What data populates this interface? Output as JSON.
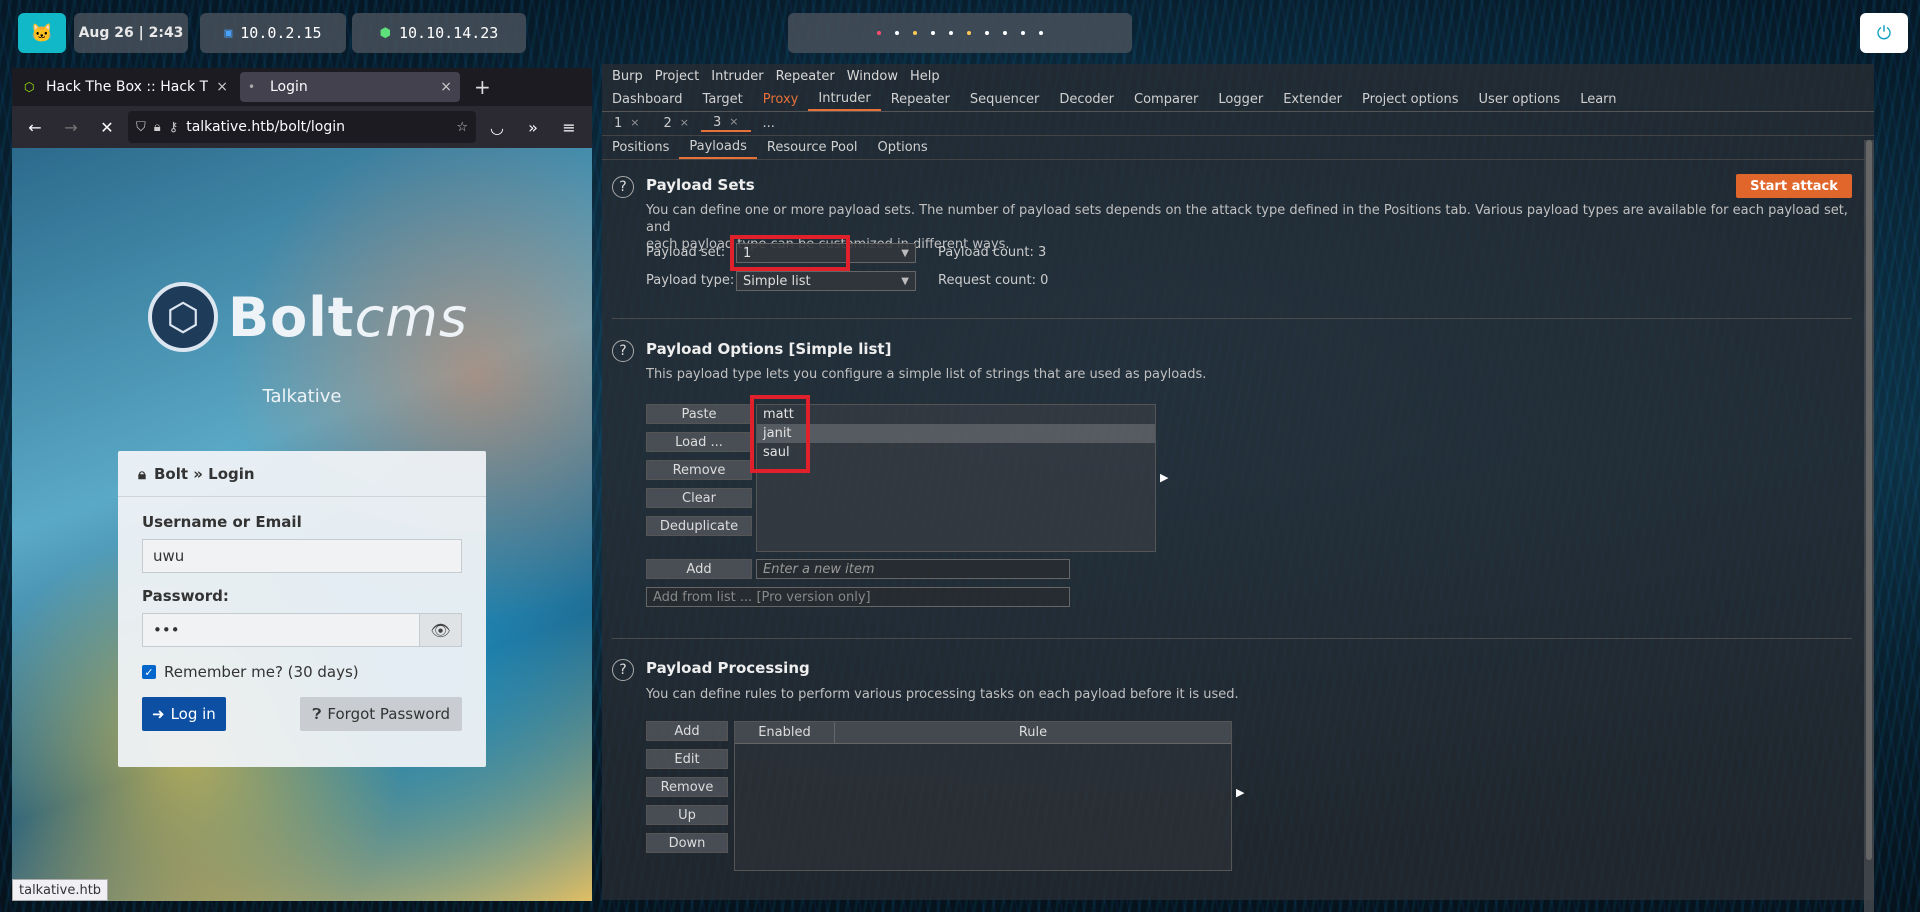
{
  "topbar": {
    "clock": "Aug 26  |  2:43",
    "ip_local": "10.0.2.15",
    "ip_vpn": "10.10.14.23",
    "workspace_colors": [
      "#ff4d6d",
      "#ffffff",
      "#ffc857",
      "#ffffff",
      "#ffffff",
      "#ffc857",
      "#ffffff",
      "#ffffff",
      "#ffffff",
      "#ffffff"
    ]
  },
  "firefox": {
    "tabs": [
      {
        "title": "Hack The Box :: Hack The Box",
        "close": "×"
      },
      {
        "title": "Login",
        "close": "×"
      }
    ],
    "new_tab": "+",
    "url": "talkative.htb/bolt/login",
    "status": "talkative.htb"
  },
  "bolt": {
    "logo_main": "Bolt",
    "logo_sub": "cms",
    "site_name": "Talkative",
    "card_title": "Bolt » Login",
    "username_label": "Username or Email",
    "username_value": "uwu",
    "password_label": "Password:",
    "password_value": "•••",
    "remember_label": "Remember me? (30 days)",
    "login_button": "Log in",
    "forgot_button": "Forgot Password"
  },
  "burp": {
    "menu": [
      "Burp",
      "Project",
      "Intruder",
      "Repeater",
      "Window",
      "Help"
    ],
    "tabs": [
      "Dashboard",
      "Target",
      "Proxy",
      "Intruder",
      "Repeater",
      "Sequencer",
      "Decoder",
      "Comparer",
      "Logger",
      "Extender",
      "Project options",
      "User options",
      "Learn"
    ],
    "sub_tabs": [
      "1",
      "2",
      "3",
      "..."
    ],
    "inner_tabs": [
      "Positions",
      "Payloads",
      "Resource Pool",
      "Options"
    ],
    "payload_sets": {
      "title": "Payload Sets",
      "start_attack": "Start attack",
      "desc1": "You can define one or more payload sets. The number of payload sets depends on the attack type defined in the Positions tab. Various payload types are available for each payload set, and",
      "desc2": "each payload type can be customized in different ways.",
      "set_label": "Payload set:",
      "set_value": "1",
      "type_label": "Payload type:",
      "type_value": "Simple list",
      "count_label": "Payload count:  3",
      "request_label": "Request count: 0"
    },
    "payload_options": {
      "title": "Payload Options [Simple list]",
      "desc": "This payload type lets you configure a simple list of strings that are used as payloads.",
      "buttons": [
        "Paste",
        "Load ...",
        "Remove",
        "Clear",
        "Deduplicate"
      ],
      "items": [
        "matt",
        "janit",
        "saul"
      ],
      "add": "Add",
      "add_placeholder": "Enter a new item",
      "add_from_list": "Add from list ... [Pro version only]"
    },
    "payload_processing": {
      "title": "Payload Processing",
      "desc": "You can define rules to perform various processing tasks on each payload before it is used.",
      "buttons": [
        "Add",
        "Edit",
        "Remove",
        "Up",
        "Down"
      ],
      "col_enabled": "Enabled",
      "col_rule": "Rule"
    }
  }
}
